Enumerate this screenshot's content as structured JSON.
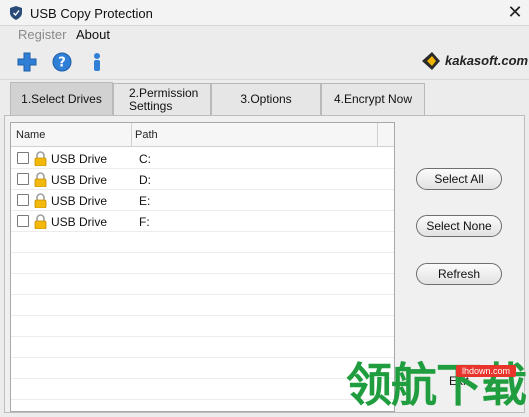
{
  "window": {
    "title": "USB Copy Protection",
    "close_glyph": "✕"
  },
  "menu": {
    "register": "Register",
    "about": "About"
  },
  "toolbar": {
    "icons": [
      "plus-icon",
      "help-icon",
      "info-icon"
    ],
    "brand": "kakasoft.com"
  },
  "tabs": [
    {
      "label": "1.Select Drives",
      "active": true
    },
    {
      "label": "2.Permission Settings",
      "active": false
    },
    {
      "label": "3.Options",
      "active": false
    },
    {
      "label": "4.Encrypt Now",
      "active": false
    }
  ],
  "list": {
    "columns": [
      "Name",
      "Path"
    ],
    "rows": [
      {
        "name": "USB Drive",
        "path": "C:",
        "checked": false
      },
      {
        "name": "USB Drive",
        "path": "D:",
        "checked": false
      },
      {
        "name": "USB Drive",
        "path": "E:",
        "checked": false
      },
      {
        "name": "USB Drive",
        "path": "F:",
        "checked": false
      }
    ]
  },
  "buttons": {
    "select_all": "Select All",
    "select_none": "Select None",
    "refresh": "Refresh",
    "exit": "Exit"
  },
  "watermark": {
    "site": "lhdown.com",
    "text": "领航下载"
  },
  "colors": {
    "active_tab": "#d2d2d2",
    "watermark_green": "#1f9d3f",
    "watermark_red": "#e8342b"
  }
}
